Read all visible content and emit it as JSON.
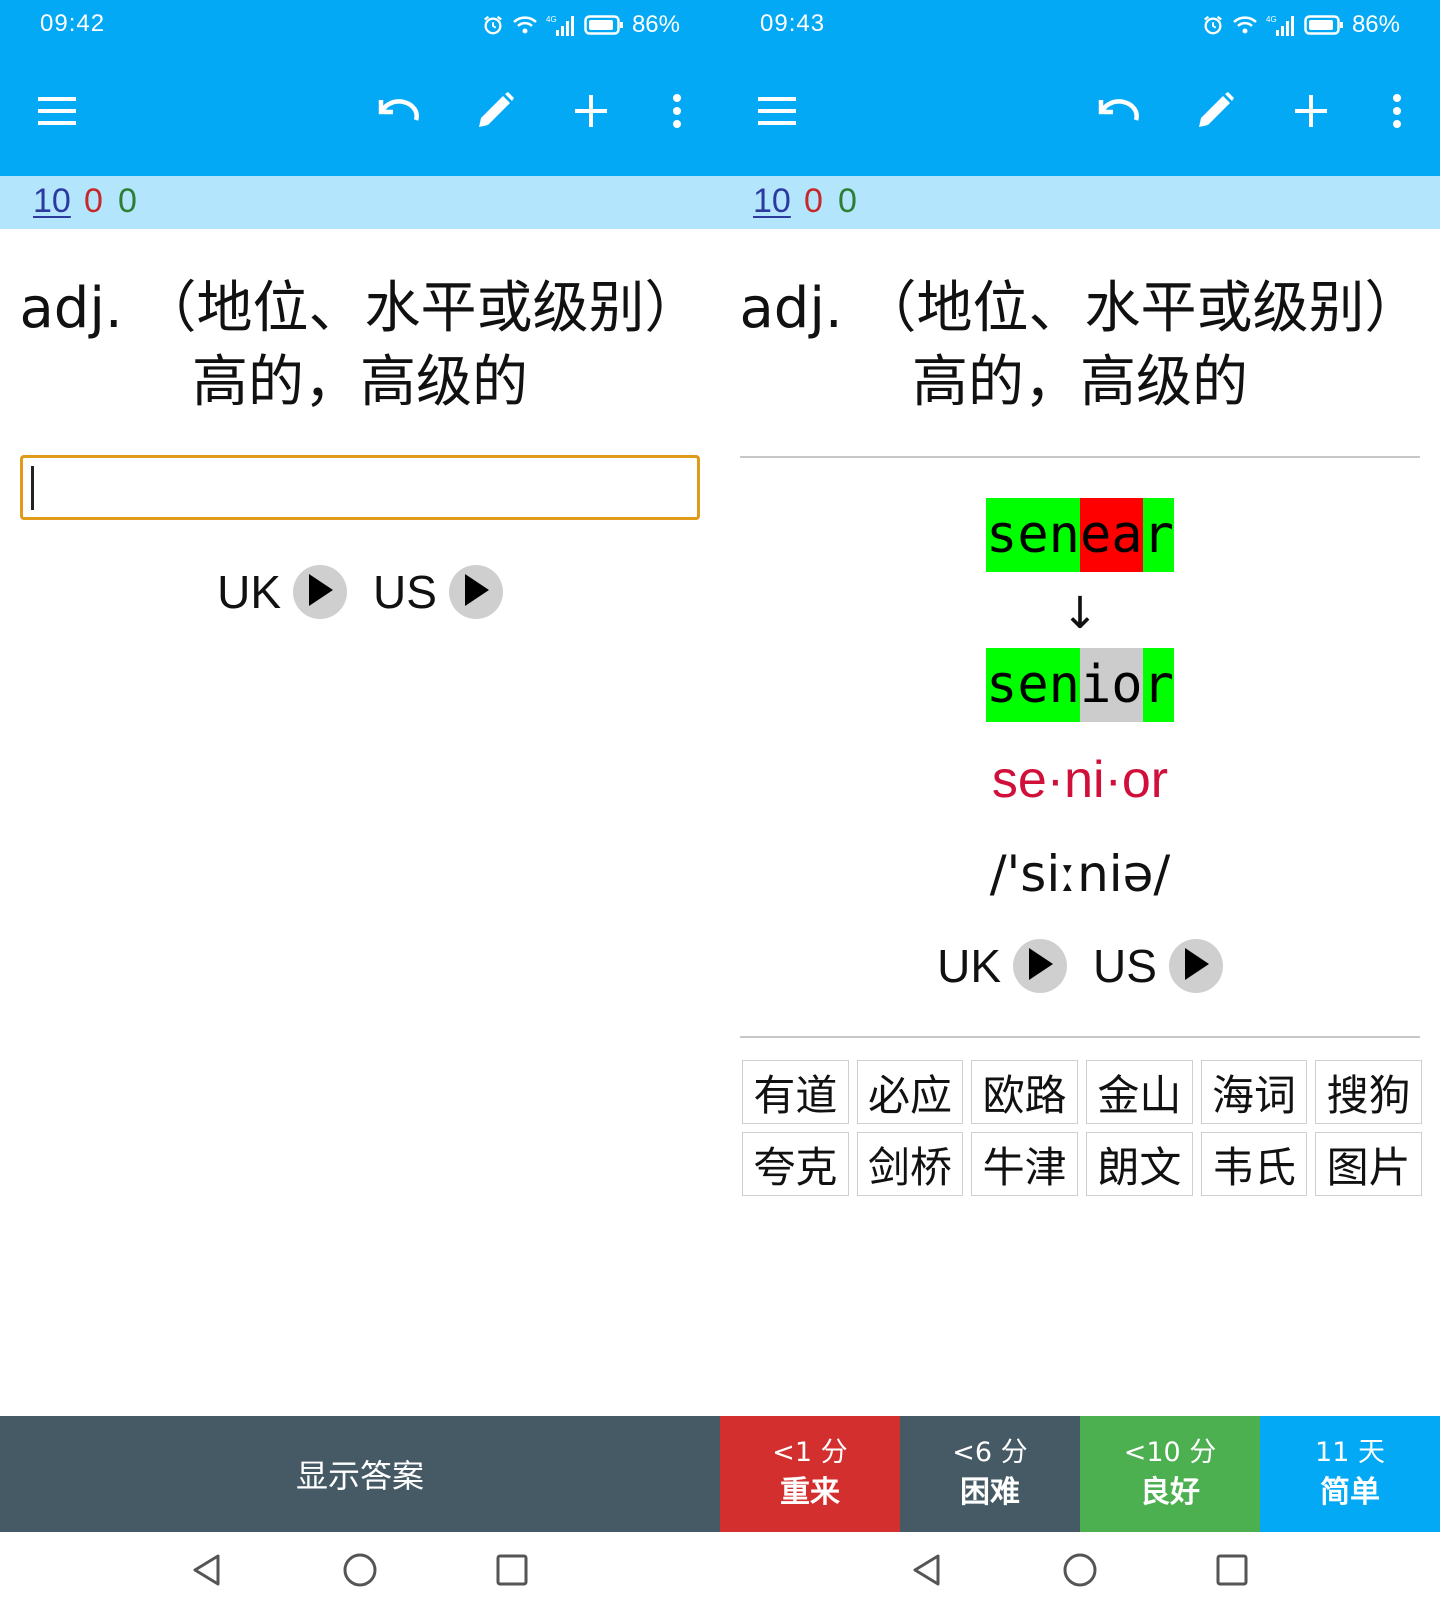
{
  "colors": {
    "app_bar": "#03a9f4",
    "counts_bar": "#b3e5fc",
    "input_border": "#e09b1a",
    "diff_correct": "#00ff00",
    "diff_wrong": "#ff0000",
    "diff_missing": "#cccccc",
    "syllables": "#d0103a",
    "show_answer_bg": "#455a64"
  },
  "toolbar_icons": [
    "menu-icon",
    "undo-icon",
    "edit-pencil-icon",
    "add-icon",
    "more-vertical-icon"
  ],
  "status_icons": [
    "alarm-icon",
    "wifi-icon",
    "signal-4g-icon",
    "battery-icon"
  ],
  "nav_icons": [
    "back-triangle-icon",
    "home-circle-icon",
    "recents-square-icon"
  ],
  "left": {
    "status": {
      "time": "09:42",
      "battery": "86%",
      "network": "4G"
    },
    "counts": {
      "new": "10",
      "learning": "0",
      "review": "0"
    },
    "question": {
      "line1": "adj. （地位、水平或级别）",
      "line2": "高的，高级的"
    },
    "input_value": "",
    "audio": {
      "uk": "UK",
      "us": "US"
    },
    "show_answer": "显示答案"
  },
  "right": {
    "status": {
      "time": "09:43",
      "battery": "86%",
      "network": "4G"
    },
    "counts": {
      "new": "10",
      "learning": "0",
      "review": "0"
    },
    "question": {
      "line1": "adj. （地位、水平或级别）",
      "line2": "高的，高级的"
    },
    "typed_diff": [
      {
        "text": "sen",
        "state": "correct"
      },
      {
        "text": "ea",
        "state": "wrong"
      },
      {
        "text": "r",
        "state": "correct"
      }
    ],
    "arrow": "↓",
    "correct_diff": [
      {
        "text": "sen",
        "state": "correct"
      },
      {
        "text": "io",
        "state": "missing"
      },
      {
        "text": "r",
        "state": "correct"
      }
    ],
    "syllables": "se·ni·or",
    "ipa": "/'siːniə/",
    "audio": {
      "uk": "UK",
      "us": "US"
    },
    "dictionaries": [
      "有道",
      "必应",
      "欧路",
      "金山",
      "海词",
      "搜狗",
      "夸克",
      "剑桥",
      "牛津",
      "朗文",
      "韦氏",
      "图片"
    ],
    "ease_buttons": [
      {
        "interval": "<1 分",
        "label": "重来",
        "color": "#d32f2f"
      },
      {
        "interval": "<6 分",
        "label": "困难",
        "color": "#455a64"
      },
      {
        "interval": "<10 分",
        "label": "良好",
        "color": "#4caf50"
      },
      {
        "interval": "11 天",
        "label": "简单",
        "color": "#03a9f4"
      }
    ]
  }
}
